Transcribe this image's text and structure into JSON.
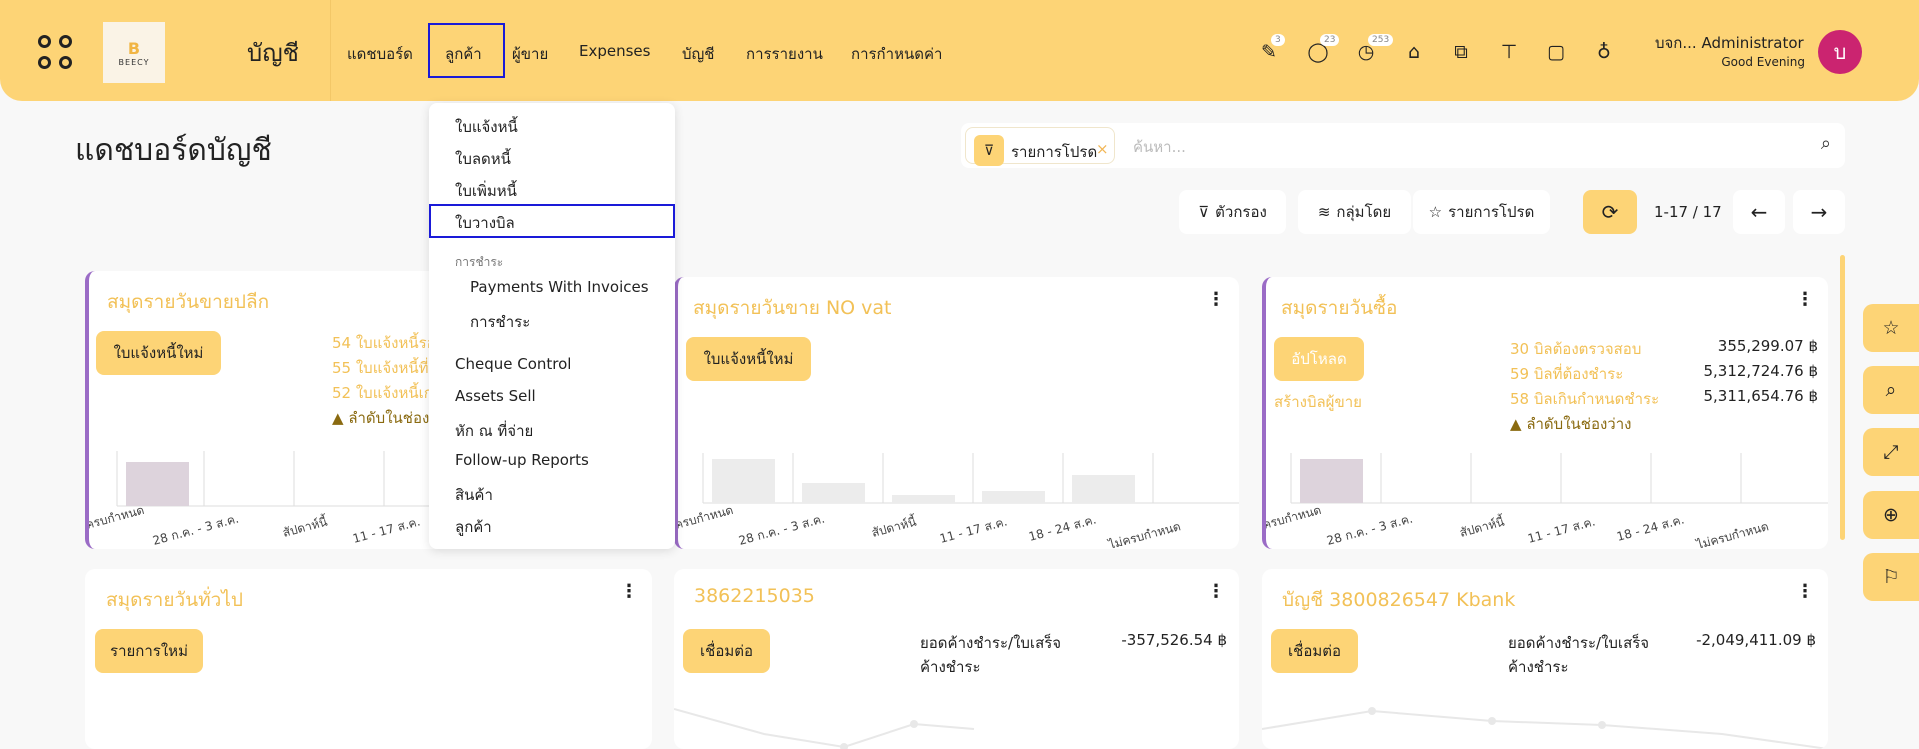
{
  "header": {
    "app_title": "บัญชี",
    "logo_text": "BEECY",
    "nav": [
      "แดชบอร์ด",
      "ลูกค้า",
      "ผู้ขาย",
      "Expenses",
      "บัญชี",
      "การรายงาน",
      "การกำหนดค่า"
    ],
    "icons": [
      {
        "name": "edit-icon",
        "badge": "3"
      },
      {
        "name": "chat-icon",
        "badge": "23"
      },
      {
        "name": "clock-icon",
        "badge": "253"
      },
      {
        "name": "bank-icon",
        "badge": ""
      },
      {
        "name": "code-icon",
        "badge": ""
      },
      {
        "name": "paint-icon",
        "badge": ""
      },
      {
        "name": "note-icon",
        "badge": ""
      },
      {
        "name": "idea-icon",
        "badge": ""
      }
    ],
    "user_name": "บจก... Administrator",
    "greeting": "Good Evening",
    "avatar_letter": "บ"
  },
  "page": {
    "title": "แดชบอร์ดบัญชี",
    "search": {
      "facet": "รายการโปรด",
      "facet_close": "×",
      "placeholder": "ค้นหา..."
    },
    "toolbar": {
      "filters": "ตัวกรอง",
      "group_by": "กลุ่มโดย",
      "favorites": "รายการโปรด",
      "pager": "1-17 / 17"
    }
  },
  "dropdown": {
    "items": [
      "ใบแจ้งหนี้",
      "ใบลดหนี้",
      "ใบเพิ่มหนี้",
      "ใบวางบิล"
    ],
    "section_head": "การชำระ",
    "sub_items": [
      "Payments With Invoices",
      "การชำระ"
    ],
    "more_items": [
      "Cheque Control",
      "Assets Sell",
      "หัก ณ ที่จ่าย",
      "Follow-up Reports",
      "สินค้า",
      "ลูกค้า"
    ]
  },
  "cards": {
    "retail": {
      "title": "สมุดรายวันขายปลีก",
      "button": "ใบแจ้งหนี้ใหม่",
      "stats": [
        "54 ใบแจ้งหนี้รอ",
        "55 ใบแจ้งหนี้ที่",
        "52 ใบแจ้งหนี้เก"
      ],
      "warning": "ลำดับในช่อง"
    },
    "novat": {
      "title": "สมุดรายวันขาย NO vat",
      "button": "ใบแจ้งหนี้ใหม่"
    },
    "purchase": {
      "title": "สมุดรายวันซื้อ",
      "button": "อัปโหลด",
      "link": "สร้างบิลผู้ขาย",
      "stats": [
        "30 บิลต้องตรวจสอบ",
        "59 บิลที่ต้องชำระ",
        "58 บิลเกินกำหนดชำระ"
      ],
      "values": [
        "355,299.07 ฿",
        "5,312,724.76 ฿",
        "5,311,654.76 ฿"
      ],
      "warning": "ลำดับในช่องว่าง"
    },
    "general": {
      "title": "สมุดรายวันทั่วไป",
      "button": "รายการใหม่"
    },
    "bank1": {
      "title": "3862215035",
      "button": "เชื่อมต่อ",
      "label1": "ยอดค้างชำระ/ใบเสร็จ",
      "label2": "ค้างชำระ",
      "value": "-357,526.54 ฿"
    },
    "bank2": {
      "title": "บัญชี 3800826547 Kbank",
      "button": "เชื่อมต่อ",
      "label1": "ยอดค้างชำระ/ใบเสร็จ",
      "label2": "ค้างชำระ",
      "value": "-2,049,411.09 ฿"
    }
  },
  "chart_data": {
    "type": "bar",
    "categories": [
      "ครบกำหนด",
      "28 ก.ค. - 3 ส.ค.",
      "สัปดาห์นี้",
      "11 - 17 ส.ค.",
      "18 - 24 ส.ค.",
      "ไม่ครบกำหนด"
    ]
  },
  "colors": {
    "brand": "#fdd476",
    "accent_bar": "#9b6cc6",
    "title_yellow": "#f2c157",
    "avatar": "#cb2470",
    "highlight_box": "#1a1ad8"
  }
}
